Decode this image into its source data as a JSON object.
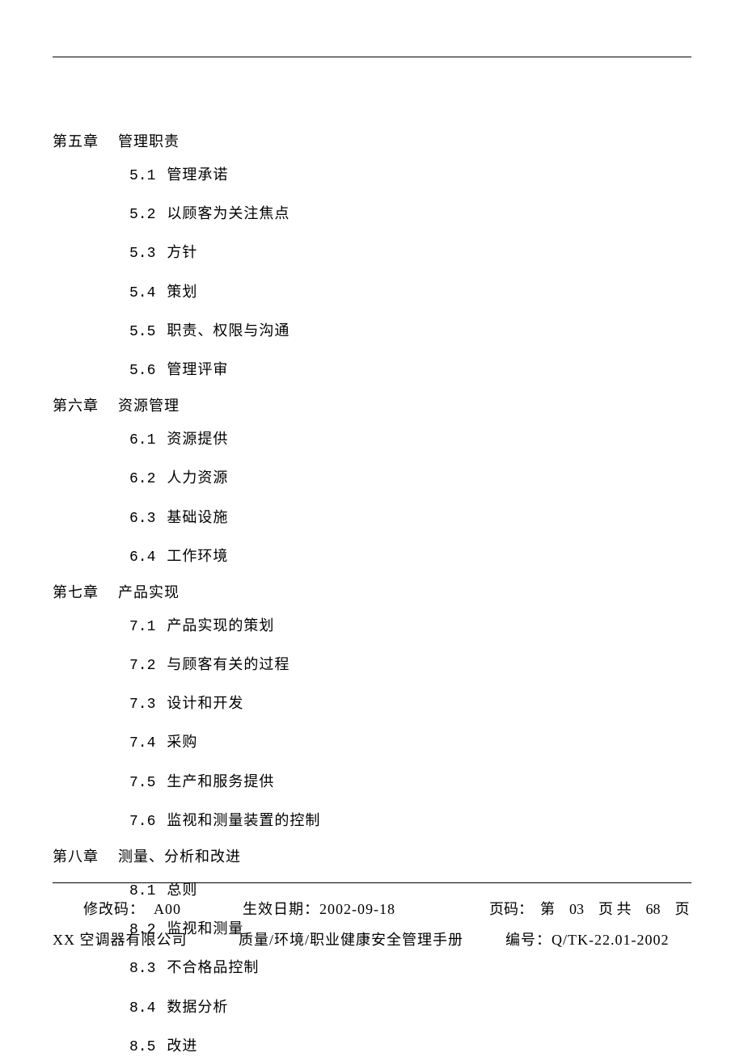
{
  "chapters": [
    {
      "prefix": "第五章",
      "title": "管理职责",
      "items": [
        {
          "num": "5.1",
          "text": "管理承诺"
        },
        {
          "num": "5.2",
          "text": "以顾客为关注焦点"
        },
        {
          "num": "5.3",
          "text": "方针"
        },
        {
          "num": "5.4",
          "text": "策划"
        },
        {
          "num": "5.5",
          "text": "职责、权限与沟通"
        },
        {
          "num": "5.6",
          "text": "管理评审"
        }
      ]
    },
    {
      "prefix": "第六章",
      "title": "资源管理",
      "items": [
        {
          "num": "6.1",
          "text": "资源提供"
        },
        {
          "num": "6.2",
          "text": "人力资源"
        },
        {
          "num": "6.3",
          "text": "基础设施"
        },
        {
          "num": "6.4",
          "text": "工作环境"
        }
      ]
    },
    {
      "prefix": "第七章",
      "title": "产品实现",
      "items": [
        {
          "num": "7.1",
          "text": "产品实现的策划"
        },
        {
          "num": "7.2",
          "text": "与顾客有关的过程"
        },
        {
          "num": "7.3",
          "text": "设计和开发"
        },
        {
          "num": "7.4",
          "text": "采购"
        },
        {
          "num": "7.5",
          "text": "生产和服务提供"
        },
        {
          "num": "7.6",
          "text": "监视和测量装置的控制"
        }
      ]
    },
    {
      "prefix": "第八章",
      "title": "测量、分析和改进",
      "items": [
        {
          "num": "8.1",
          "text": "总则"
        },
        {
          "num": "8.2",
          "text": "监视和测量"
        },
        {
          "num": "8.3",
          "text": "不合格品控制"
        },
        {
          "num": "8.4",
          "text": "数据分析"
        },
        {
          "num": "8.5",
          "text": "改进"
        }
      ]
    }
  ],
  "footer": {
    "rev_label": "修改码：",
    "rev_value": "A00",
    "date_label": "生效日期：",
    "date_value": "2002-09-18",
    "page_label": "页码：",
    "page_text": "第　03　页 共　68　页",
    "company": "XX 空调器有限公司",
    "manual_title": "质量/环境/职业健康安全管理手册",
    "doc_label": "编号：",
    "doc_value": "Q/TK-22.01-2002"
  }
}
